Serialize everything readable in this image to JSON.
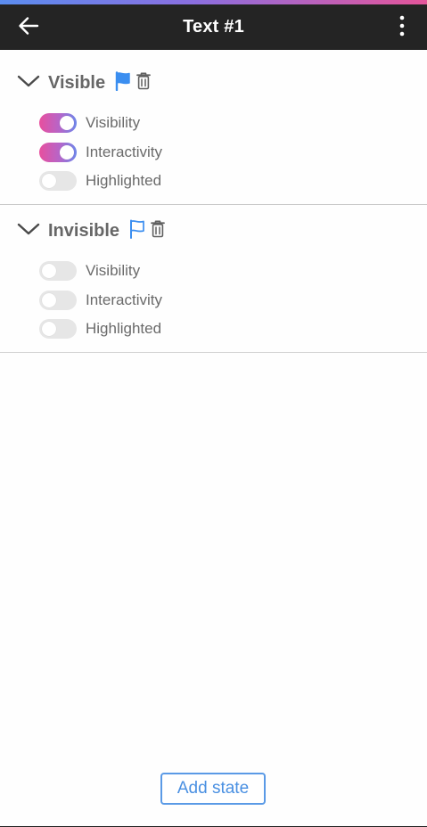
{
  "header": {
    "title": "Text #1",
    "back_icon": "arrow-left-icon",
    "menu_icon": "more-vertical-icon"
  },
  "colors": {
    "topbar": "#242424",
    "accent_gradient": [
      "#5b8def",
      "#e5559a"
    ],
    "toggle_on_gradient": [
      "#e84f9e",
      "#6d86ea"
    ],
    "toggle_off": "#e6e6e6",
    "link_blue": "#4a90e2"
  },
  "states": [
    {
      "name": "Visible",
      "expanded": true,
      "default_flag": true,
      "toggles": [
        {
          "label": "Visibility",
          "on": true
        },
        {
          "label": "Interactivity",
          "on": true
        },
        {
          "label": "Highlighted",
          "on": false
        }
      ]
    },
    {
      "name": "Invisible",
      "expanded": true,
      "default_flag": false,
      "toggles": [
        {
          "label": "Visibility",
          "on": false
        },
        {
          "label": "Interactivity",
          "on": false
        },
        {
          "label": "Highlighted",
          "on": false
        }
      ]
    }
  ],
  "footer": {
    "add_state_label": "Add state"
  }
}
